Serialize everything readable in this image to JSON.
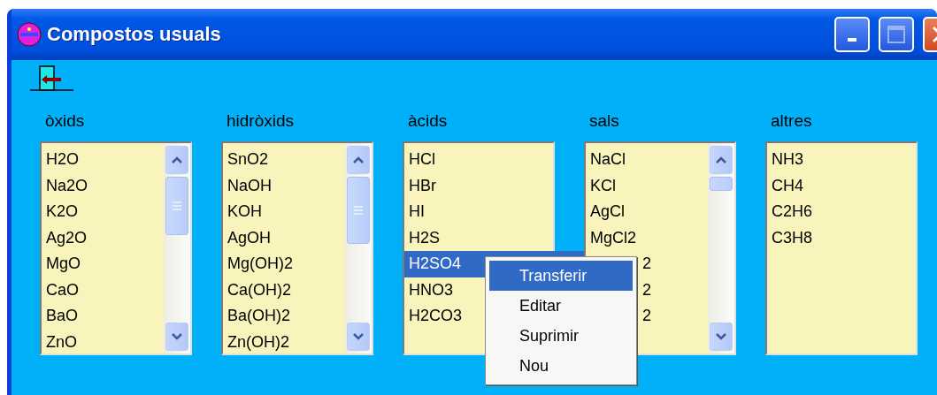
{
  "window": {
    "title": "Compostos usuals"
  },
  "lists": [
    {
      "label": "òxids",
      "scrollbar": true,
      "items": [
        {
          "text": "H2O",
          "selected": false
        },
        {
          "text": "Na2O",
          "selected": false
        },
        {
          "text": "K2O",
          "selected": false
        },
        {
          "text": "Ag2O",
          "selected": false
        },
        {
          "text": "MgO",
          "selected": false
        },
        {
          "text": "CaO",
          "selected": false
        },
        {
          "text": "BaO",
          "selected": false
        },
        {
          "text": "ZnO",
          "selected": false
        }
      ]
    },
    {
      "label": "hidròxids",
      "scrollbar": true,
      "items": [
        {
          "text": "SnO2",
          "selected": false
        },
        {
          "text": "NaOH",
          "selected": false
        },
        {
          "text": "KOH",
          "selected": false
        },
        {
          "text": "AgOH",
          "selected": false
        },
        {
          "text": "Mg(OH)2",
          "selected": false
        },
        {
          "text": "Ca(OH)2",
          "selected": false
        },
        {
          "text": "Ba(OH)2",
          "selected": false
        },
        {
          "text": "Zn(OH)2",
          "selected": false
        }
      ]
    },
    {
      "label": "àcids",
      "scrollbar": false,
      "items": [
        {
          "text": "HCl",
          "selected": false
        },
        {
          "text": "HBr",
          "selected": false
        },
        {
          "text": "HI",
          "selected": false
        },
        {
          "text": "H2S",
          "selected": false
        },
        {
          "text": "H2SO4",
          "selected": true
        },
        {
          "text": "HNO3",
          "selected": false
        },
        {
          "text": "H2CO3",
          "selected": false
        }
      ]
    },
    {
      "label": "sals",
      "scrollbar": true,
      "items": [
        {
          "text": "NaCl",
          "selected": false
        },
        {
          "text": "KCl",
          "selected": false
        },
        {
          "text": "AgCl",
          "selected": false
        },
        {
          "text": "MgCl2",
          "selected": false
        },
        {
          "text": "2",
          "selected": false,
          "kind": "covered"
        },
        {
          "text": "2",
          "selected": false,
          "kind": "covered"
        },
        {
          "text": "2",
          "selected": false,
          "kind": "covered"
        }
      ]
    },
    {
      "label": "altres",
      "scrollbar": false,
      "items": [
        {
          "text": "NH3",
          "selected": false
        },
        {
          "text": "CH4",
          "selected": false
        },
        {
          "text": "C2H6",
          "selected": false
        },
        {
          "text": "C3H8",
          "selected": false
        }
      ]
    }
  ],
  "context_menu": {
    "items": [
      {
        "text": "Transferir",
        "selected": true
      },
      {
        "text": "Editar",
        "selected": false
      },
      {
        "text": "Suprimir",
        "selected": false
      },
      {
        "text": "Nou",
        "selected": false
      }
    ]
  }
}
